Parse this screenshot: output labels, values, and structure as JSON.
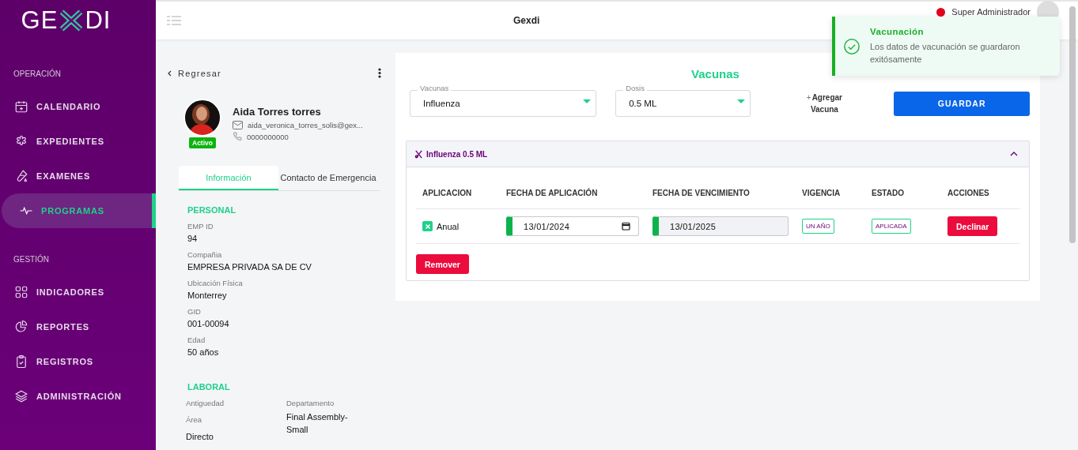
{
  "sidebar": {
    "logo": {
      "left": "GE",
      "right": "DI"
    },
    "sections": [
      {
        "title": "OPERACIÓN",
        "items": [
          {
            "label": "CALENDARIO",
            "selected": false
          },
          {
            "label": "EXPEDIENTES",
            "selected": false
          },
          {
            "label": "EXAMENES",
            "selected": false
          },
          {
            "label": "PROGRAMAS",
            "selected": true
          }
        ]
      },
      {
        "title": "GESTIÓN",
        "items": [
          {
            "label": "INDICADORES",
            "selected": false
          },
          {
            "label": "REPORTES",
            "selected": false
          },
          {
            "label": "REGISTROS",
            "selected": false
          },
          {
            "label": "ADMINISTRACIÓN",
            "selected": false
          }
        ]
      }
    ]
  },
  "header": {
    "title": "Gexdi",
    "user": "Super Administrador"
  },
  "toast": {
    "title": "Vacunación",
    "message": "Los datos de vacunación se guardaron exitósamente"
  },
  "profile": {
    "back": "Regresar",
    "name": "Aida Torres torres",
    "email": "aida_veronica_torres_solis@gex...",
    "phone": "0000000000",
    "status": "Activo",
    "tabs": [
      {
        "label": "Información",
        "selected": true
      },
      {
        "label": "Contacto de Emergencia",
        "selected": false
      }
    ],
    "personal": {
      "title": "PERSONAL",
      "fields": [
        {
          "label": "EMP ID",
          "value": "94"
        },
        {
          "label": "Compañia",
          "value": "EMPRESA PRIVADA SA DE CV"
        },
        {
          "label": "Ubicación Física",
          "value": "Monterrey"
        },
        {
          "label": "GID",
          "value": "001-00094"
        },
        {
          "label": "Edad",
          "value": "50 años"
        }
      ]
    },
    "laboral": {
      "title": "LABORAL",
      "column_1": [
        {
          "label": "Antiguedad"
        },
        {
          "label": "Área",
          "value": "Directo"
        }
      ],
      "column_2": [
        {
          "label": "Departamento",
          "value": "Final Assembly-Small"
        }
      ]
    }
  },
  "vaccines": {
    "title": "Vacunas",
    "selects": [
      {
        "label": "Vacunas",
        "value": "Influenza"
      },
      {
        "label": "Dosis",
        "value": "0.5 ML"
      }
    ],
    "add": {
      "icon": "+",
      "label": "Agregar Vacuna"
    },
    "save": "GUARDAR",
    "panel": {
      "title": "Influenza 0.5 ML",
      "expanded": true,
      "columns": [
        "APLICACION",
        "FECHA DE APLICACIÓN",
        "FECHA DE VENCIMIENTO",
        "VIGENCIA",
        "ESTADO",
        "ACCIONES"
      ],
      "rows": [
        {
          "checked": true,
          "label": "Anual",
          "applied": "13/01/2024",
          "expires": "13/01/2025",
          "validity": "UN AÑO",
          "status": "APLICADA",
          "action": "Declinar"
        }
      ],
      "remove": "Remover"
    }
  }
}
